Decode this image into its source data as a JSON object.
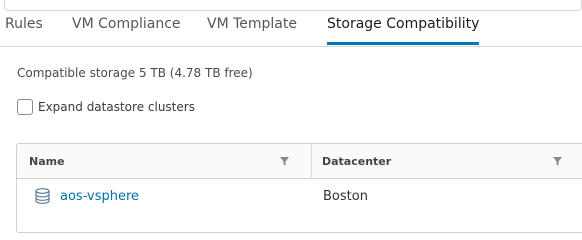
{
  "tabs": [
    {
      "label": "Rules",
      "active": false
    },
    {
      "label": "VM Compliance",
      "active": false
    },
    {
      "label": "VM Template",
      "active": false
    },
    {
      "label": "Storage Compatibility",
      "active": true
    }
  ],
  "summary": {
    "capacity_text": "Compatible storage 5 TB (4.78 TB free)"
  },
  "options": {
    "expand_label": "Expand datastore clusters",
    "expand_checked": false
  },
  "grid": {
    "columns": [
      "Name",
      "Datacenter"
    ],
    "rows": [
      {
        "name": "aos-vsphere",
        "datacenter": "Boston",
        "icon": "datastore-icon"
      }
    ]
  },
  "colors": {
    "accent": "#0079b8",
    "link": "#0072a3"
  }
}
